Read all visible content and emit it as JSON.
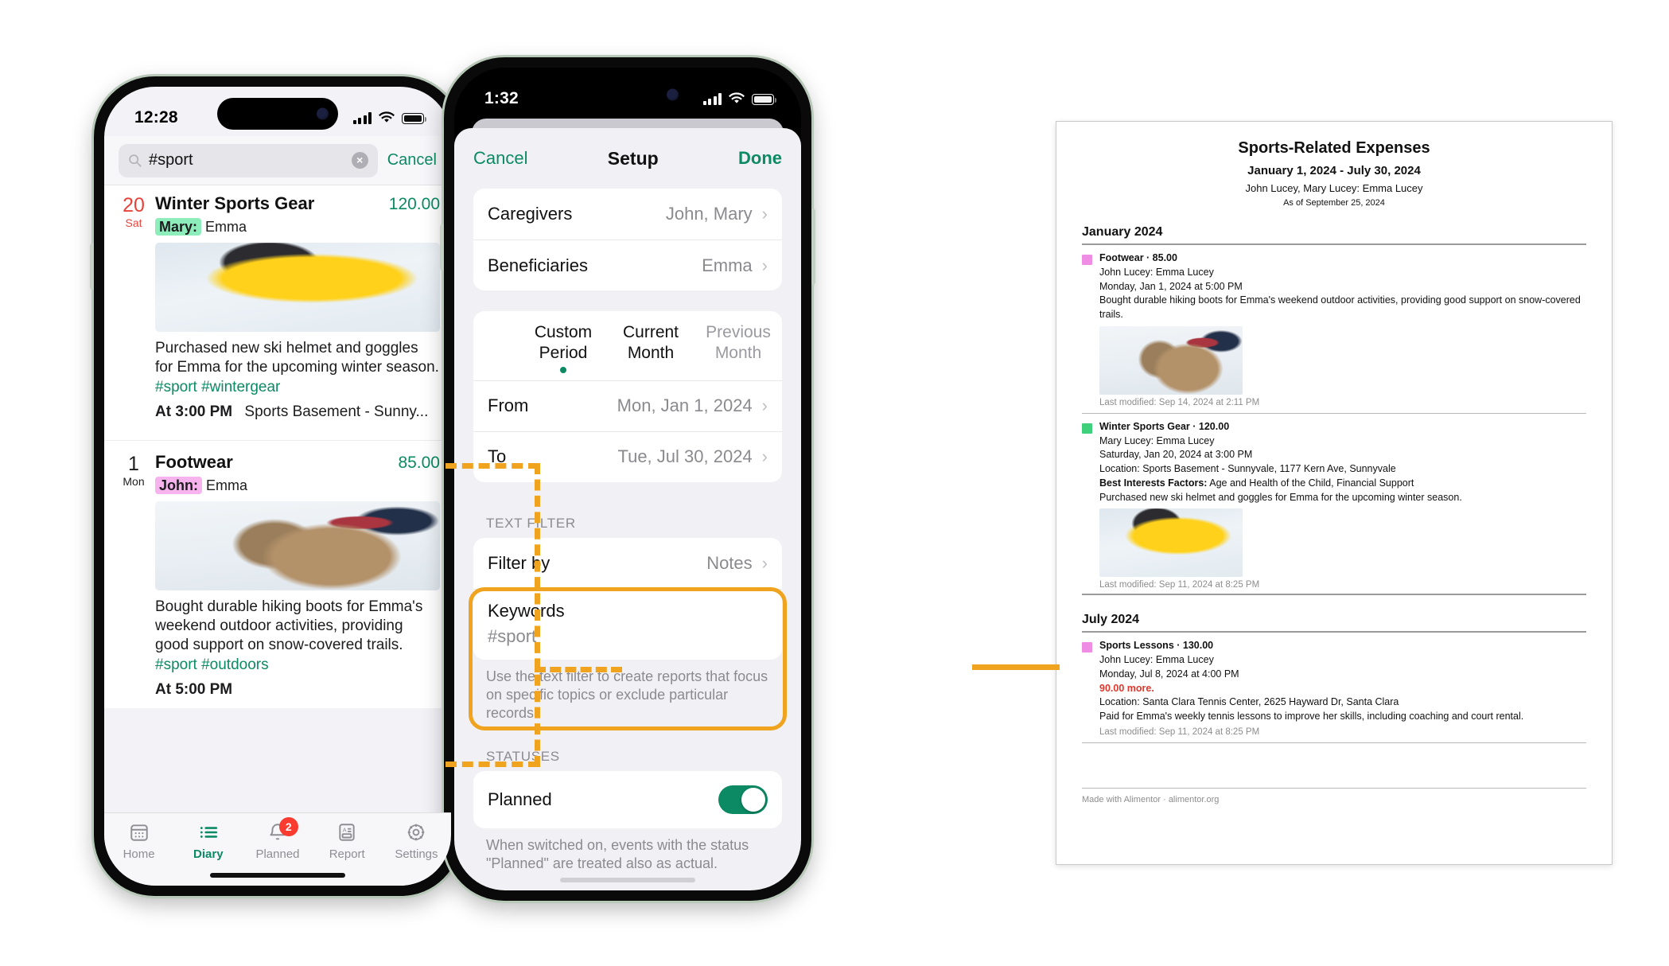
{
  "phone1": {
    "status": {
      "time": "12:28",
      "signal_icon": "cellular-bars-icon",
      "wifi_icon": "wifi-icon",
      "battery_icon": "battery-icon"
    },
    "search": {
      "icon": "search-icon",
      "value": "#sport",
      "clear_icon": "clear-circle-icon",
      "clear_glyph": "×",
      "cancel_label": "Cancel"
    },
    "entries": [
      {
        "day": "20",
        "dow": "Sat",
        "date_color": "red",
        "title": "Winter Sports Gear",
        "amount": "120.00",
        "person_chip": "Mary:",
        "person_chip_color": "green",
        "person_name": "Emma",
        "photo": "skier-in-yellow-jacket-photo",
        "note": "Purchased new ski helmet and goggles for Emma for the upcoming winter season.",
        "tags": "#sport #wintergear",
        "time_label": "At 3:00 PM",
        "location": "Sports Basement - Sunny..."
      },
      {
        "day": "1",
        "dow": "Mon",
        "date_color": "plain",
        "title": "Footwear",
        "amount": "85.00",
        "person_chip": "John:",
        "person_chip_color": "pink",
        "person_name": "Emma",
        "photo": "hiking-boots-in-snow-photo",
        "note": "Bought durable hiking boots for Emma's weekend outdoor activities, providing good support on snow-covered trails.",
        "tags": "#sport #outdoors",
        "time_label": "At 5:00 PM",
        "location": ""
      }
    ],
    "tabs": [
      {
        "label": "Home",
        "icon": "calendar-icon",
        "active": false,
        "badge": ""
      },
      {
        "label": "Diary",
        "icon": "list-icon",
        "active": true,
        "badge": ""
      },
      {
        "label": "Planned",
        "icon": "bell-icon",
        "active": false,
        "badge": "2"
      },
      {
        "label": "Report",
        "icon": "document-icon",
        "active": false,
        "badge": ""
      },
      {
        "label": "Settings",
        "icon": "gear-icon",
        "active": false,
        "badge": ""
      }
    ]
  },
  "phone2": {
    "status": {
      "time": "1:32",
      "signal_icon": "cellular-bars-icon",
      "wifi_icon": "wifi-icon",
      "battery_icon": "battery-icon"
    },
    "nav": {
      "cancel_label": "Cancel",
      "title": "Setup",
      "done_label": "Done"
    },
    "people": [
      {
        "label": "Caregivers",
        "value": "John, Mary"
      },
      {
        "label": "Beneficiaries",
        "value": "Emma"
      }
    ],
    "period_segments": [
      {
        "label": "Custom Period",
        "selected": true
      },
      {
        "label": "Current Month",
        "selected": false
      },
      {
        "label": "Previous Month",
        "selected": false
      }
    ],
    "period_rows": [
      {
        "label": "From",
        "value": "Mon, Jan 1, 2024"
      },
      {
        "label": "To",
        "value": "Tue, Jul 30, 2024"
      }
    ],
    "text_filter": {
      "section_header": "TEXT FILTER",
      "filter_by_label": "Filter by",
      "filter_by_value": "Notes",
      "keywords_label": "Keywords",
      "keywords_value": "#sport",
      "footnote": "Use the text filter to create reports that focus on specific topics or exclude particular records."
    },
    "statuses": {
      "section_header": "STATUSES",
      "planned_label": "Planned",
      "planned_on": true,
      "footnote": "When switched on, events with the status \"Planned\" are treated also as actual."
    }
  },
  "report": {
    "title": "Sports-Related Expenses",
    "date_range": "January 1, 2024 - July 30, 2024",
    "people": "John Lucey, Mary Lucey: Emma Lucey",
    "as_of": "As of September 25, 2024",
    "sections": [
      {
        "month": "January 2024",
        "records": [
          {
            "swatch_color": "#ef8de4",
            "heading": "Footwear · 85.00",
            "people": "John Lucey: Emma Lucey",
            "datetime": "Monday, Jan 1, 2024 at 5:00 PM",
            "more": "",
            "location": "",
            "factors_label": "",
            "factors_value": "",
            "note": "Bought durable hiking boots for Emma's weekend outdoor activities, providing good support on snow-covered trails.",
            "photo": "hiking-boots-in-snow-photo",
            "last_modified": "Last modified: Sep 14, 2024 at 2:11 PM"
          },
          {
            "swatch_color": "#3ed07a",
            "heading": "Winter Sports Gear · 120.00",
            "people": "Mary Lucey: Emma Lucey",
            "datetime": "Saturday, Jan 20, 2024 at 3:00 PM",
            "more": "",
            "location": "Location: Sports Basement - Sunnyvale, 1177 Kern Ave, Sunnyvale",
            "factors_label": "Best Interests Factors:",
            "factors_value": " Age and Health of the Child, Financial Support",
            "note": "Purchased new ski helmet and goggles for Emma for the upcoming winter season.",
            "photo": "skier-in-yellow-jacket-photo",
            "last_modified": "Last modified: Sep 11, 2024 at 8:25 PM"
          }
        ]
      },
      {
        "month": "July 2024",
        "records": [
          {
            "swatch_color": "#ef8de4",
            "heading": "Sports Lessons · 130.00",
            "people": "John Lucey: Emma Lucey",
            "datetime": "Monday, Jul 8, 2024 at 4:00 PM",
            "more": "90.00 more.",
            "location": "Location: Santa Clara Tennis Center, 2625 Hayward Dr, Santa Clara",
            "factors_label": "",
            "factors_value": "",
            "note": "Paid for Emma's weekly tennis lessons to improve her skills, including coaching and court rental.",
            "photo": "",
            "last_modified": "Last modified: Sep 11, 2024 at 8:25 PM"
          }
        ]
      }
    ],
    "footer": "Made with Alimentor  ·  alimentor.org"
  },
  "annotation": {
    "accent_color": "#f0a31e"
  }
}
